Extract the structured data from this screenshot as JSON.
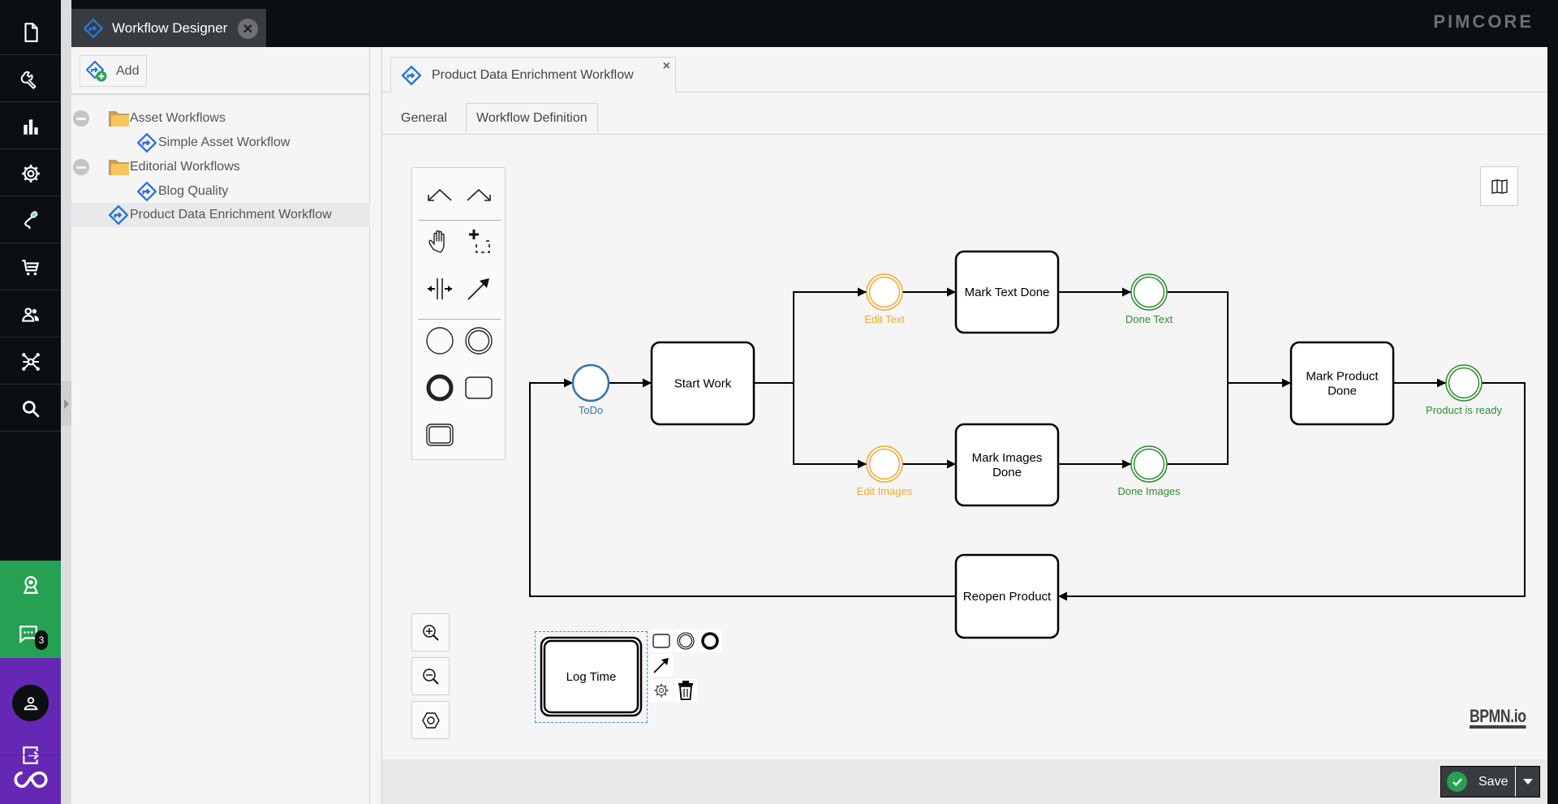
{
  "sidebar": {
    "items": [
      {
        "icon": "document-icon",
        "label": "Documents"
      },
      {
        "icon": "wrench-icon",
        "label": "Tools"
      },
      {
        "icon": "bar-chart-icon",
        "label": "Marketing"
      },
      {
        "icon": "gear-icon",
        "label": "Settings"
      },
      {
        "icon": "plug-icon",
        "label": "Data Hub"
      },
      {
        "icon": "cart-icon",
        "label": "E-Commerce"
      },
      {
        "icon": "users-icon",
        "label": "Users"
      },
      {
        "icon": "network-icon",
        "label": "Data Object Relations"
      },
      {
        "icon": "search-icon",
        "label": "Search"
      }
    ],
    "notification_badge": "3",
    "colors": {
      "green": "#26a052",
      "purple": "#6428b4",
      "dark": "#0c0f12"
    }
  },
  "top_tab": {
    "label": "Workflow Designer"
  },
  "brand": "PIMCORE",
  "tree": {
    "add_label": "Add",
    "items": [
      {
        "type": "folder",
        "label": "Asset Workflows",
        "expanded": true
      },
      {
        "type": "workflow",
        "label": "Simple Asset Workflow"
      },
      {
        "type": "folder",
        "label": "Editorial Workflows",
        "expanded": true
      },
      {
        "type": "workflow",
        "label": "Blog Quality"
      },
      {
        "type": "workflow",
        "label": "Product Data Enrichment Workflow",
        "selected": true
      }
    ]
  },
  "document_tab": {
    "label": "Product Data Enrichment Workflow",
    "close": "×"
  },
  "subtabs": [
    {
      "label": "General",
      "active": false
    },
    {
      "label": "Workflow Definition",
      "active": true
    }
  ],
  "palette": {
    "tools": [
      "undo-icon",
      "redo-icon",
      "hand-tool-icon",
      "lasso-tool-icon",
      "space-tool-icon",
      "connect-tool-icon",
      "place-icon",
      "place-intermediate-icon",
      "place-end-icon",
      "transition-icon",
      "global-action-icon"
    ]
  },
  "diagram": {
    "places": [
      {
        "id": "todo",
        "label": "ToDo",
        "color": "#3b73b0",
        "style": "single"
      },
      {
        "id": "edit_text",
        "label": "Edit Text",
        "color": "#f0a830",
        "style": "double"
      },
      {
        "id": "edit_images",
        "label": "Edit Images",
        "color": "#f0a830",
        "style": "double"
      },
      {
        "id": "done_text",
        "label": "Done Text",
        "color": "#2e8b2e",
        "style": "double"
      },
      {
        "id": "done_images",
        "label": "Done Images",
        "color": "#2e8b2e",
        "style": "double"
      },
      {
        "id": "product_ready",
        "label": "Product is ready",
        "color": "#2e8b2e",
        "style": "double"
      }
    ],
    "transitions": [
      {
        "id": "start_work",
        "label": [
          "Start Work"
        ]
      },
      {
        "id": "mark_text_done",
        "label": [
          "Mark Text Done"
        ]
      },
      {
        "id": "mark_images_done",
        "label": [
          "Mark Images",
          "Done"
        ]
      },
      {
        "id": "mark_product_done",
        "label": [
          "Mark Product",
          "Done"
        ]
      },
      {
        "id": "reopen_product",
        "label": [
          "Reopen Product"
        ]
      },
      {
        "id": "log_time",
        "label": [
          "Log Time"
        ],
        "global_action": true,
        "selected": true
      }
    ],
    "flows": [
      [
        "todo",
        "start_work"
      ],
      [
        "start_work",
        "edit_text"
      ],
      [
        "start_work",
        "edit_images"
      ],
      [
        "edit_text",
        "mark_text_done"
      ],
      [
        "edit_images",
        "mark_images_done"
      ],
      [
        "mark_text_done",
        "done_text"
      ],
      [
        "mark_images_done",
        "done_images"
      ],
      [
        "done_text",
        "mark_product_done"
      ],
      [
        "done_images",
        "mark_product_done"
      ],
      [
        "mark_product_done",
        "product_ready"
      ],
      [
        "product_ready",
        "reopen_product"
      ],
      [
        "reopen_product",
        "todo"
      ]
    ]
  },
  "context_pad": [
    "append-transition-icon",
    "append-place-icon",
    "append-end-place-icon",
    "connect-icon",
    "settings-icon",
    "delete-icon"
  ],
  "zoom_controls": [
    "zoom-in-icon",
    "zoom-out-icon",
    "reset-zoom-icon"
  ],
  "minimap_toggle": "map-icon",
  "watermark": "BPMN.io",
  "save": {
    "label": "Save"
  }
}
